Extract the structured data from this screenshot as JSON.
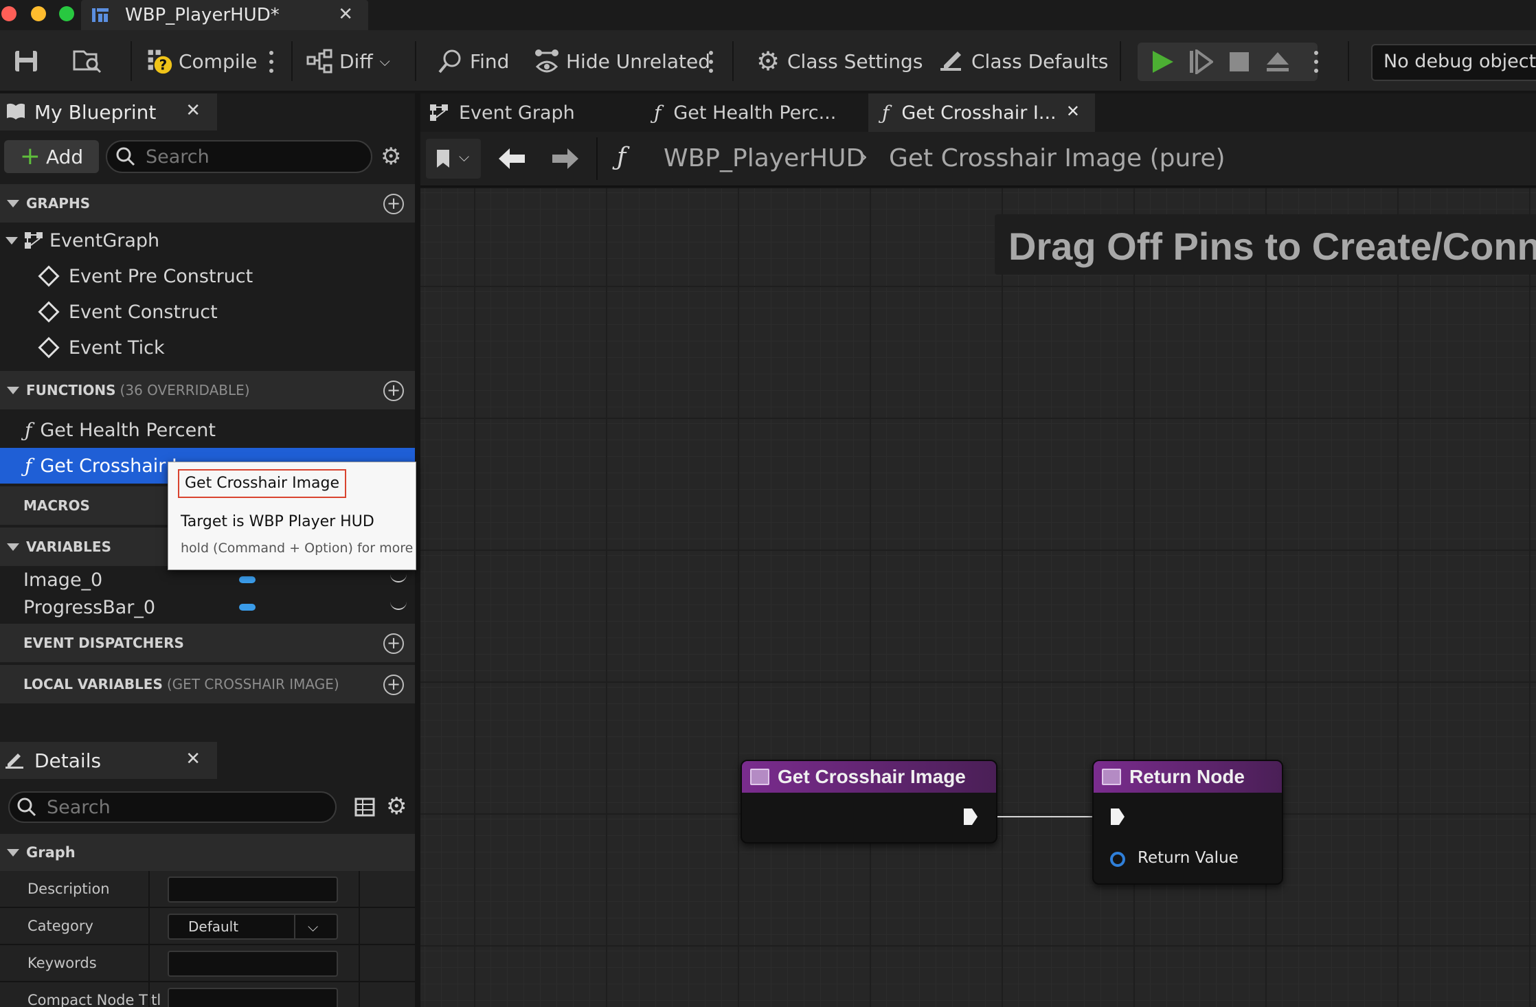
{
  "window": {
    "tab_title": "WBP_PlayerHUD*",
    "colors": {
      "close": "#fe5f57",
      "minimize": "#febc2e",
      "zoom": "#28c840"
    }
  },
  "toolbar": {
    "compile_label": "Compile",
    "diff_label": "Diff",
    "find_label": "Find",
    "hide_unrelated_label": "Hide Unrelated",
    "class_settings_label": "Class Settings",
    "class_defaults_label": "Class Defaults",
    "debug_object": "No debug object se",
    "play_color": "#4caf33"
  },
  "my_blueprint": {
    "tab_label": "My Blueprint",
    "add_label": "Add",
    "search_placeholder": "Search",
    "sections": {
      "graphs": "GRAPHS",
      "functions": "FUNCTIONS",
      "functions_note": "(36 OVERRIDABLE)",
      "macros": "MACROS",
      "variables": "VARIABLES",
      "event_dispatchers": "EVENT DISPATCHERS",
      "local_variables": "LOCAL VARIABLES",
      "local_variables_note": "(GET CROSSHAIR IMAGE)"
    },
    "graphs": {
      "event_graph": "EventGraph",
      "events": [
        "Event Pre Construct",
        "Event Construct",
        "Event Tick"
      ]
    },
    "functions": [
      "Get Health Percent",
      "Get Crosshair I"
    ],
    "variables": [
      "Image_0",
      "ProgressBar_0"
    ],
    "selection_color": "#1f5fd6",
    "variable_color": "#3a9be8"
  },
  "tooltip": {
    "title": "Get Crosshair Image",
    "target": "Target is WBP Player HUD",
    "hint": "hold (Command + Option) for more"
  },
  "details": {
    "tab_label": "Details",
    "search_placeholder": "Search",
    "section": "Graph",
    "rows": {
      "description": "Description",
      "category": "Category",
      "category_value": "Default",
      "keywords": "Keywords",
      "compact_title": "Compact Node Titl"
    }
  },
  "graph_tabs": [
    "Event Graph",
    "Get Health Perc...",
    "Get Crosshair I..."
  ],
  "breadcrumb": {
    "blueprint": "WBP_PlayerHUD",
    "function": "Get Crosshair Image (pure)"
  },
  "canvas": {
    "hint": "Drag Off Pins to Create/Connec",
    "nodes": {
      "entry_title": "Get Crosshair Image",
      "return_title": "Return Node",
      "return_value_label": "Return Value"
    },
    "node_header_color": "#7a2c8e",
    "return_pin_color": "#2f7fd9"
  }
}
